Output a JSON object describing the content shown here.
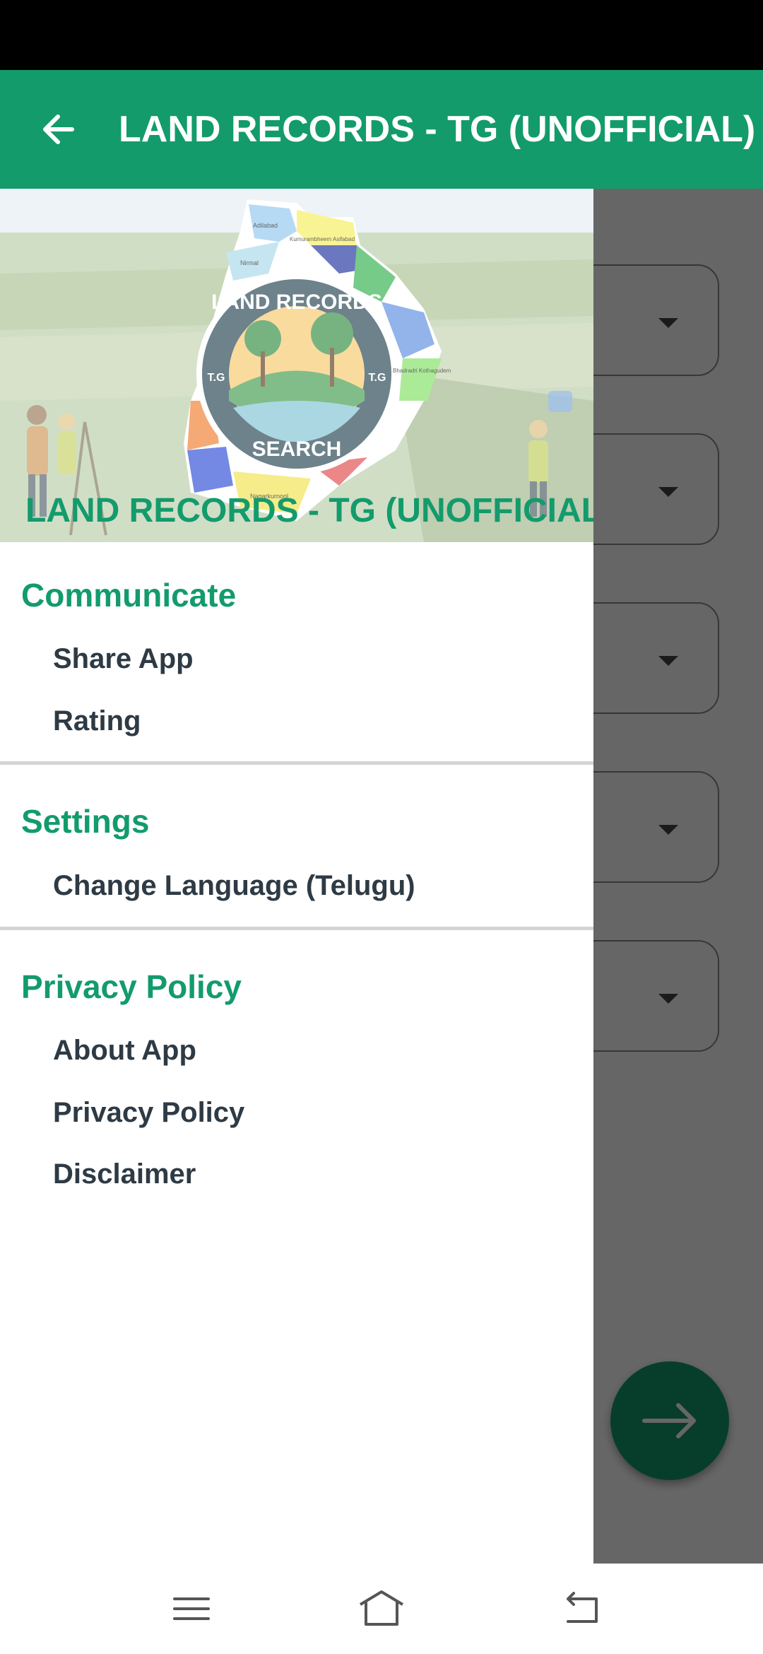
{
  "app_bar": {
    "title": "LAND RECORDS - TG (UNOFFICIAL)",
    "back_icon": "arrow-left-icon"
  },
  "drawer": {
    "header": {
      "title": "LAND RECORDS - TG (UNOFFICIAL)",
      "logo_text_top": "LAND RECORDS",
      "logo_text_bottom": "SEARCH",
      "logo_badge_left": "T.G",
      "logo_badge_right": "T.G",
      "map_labels": [
        "Adilabad",
        "Kumurambheem Asifabad",
        "Nirmal",
        "Nagarkurnool",
        "Bhadradri Kothagudem"
      ]
    },
    "sections": [
      {
        "title": "Communicate",
        "items": [
          "Share App",
          "Rating"
        ]
      },
      {
        "title": "Settings",
        "items": [
          "Change Language (Telugu)"
        ]
      },
      {
        "title": "Privacy Policy",
        "items": [
          "About App",
          "Privacy Policy",
          "Disclaimer"
        ]
      }
    ]
  },
  "background": {
    "dropdown_count": 5,
    "fab_icon": "arrow-right-icon"
  },
  "nav_bar": {
    "icons": [
      "menu-icon",
      "home-icon",
      "back-icon"
    ]
  },
  "colors": {
    "primary": "#139b6c",
    "status_bar": "#000000",
    "menu_text": "#2e3a44",
    "divider": "#d4d4d4"
  }
}
